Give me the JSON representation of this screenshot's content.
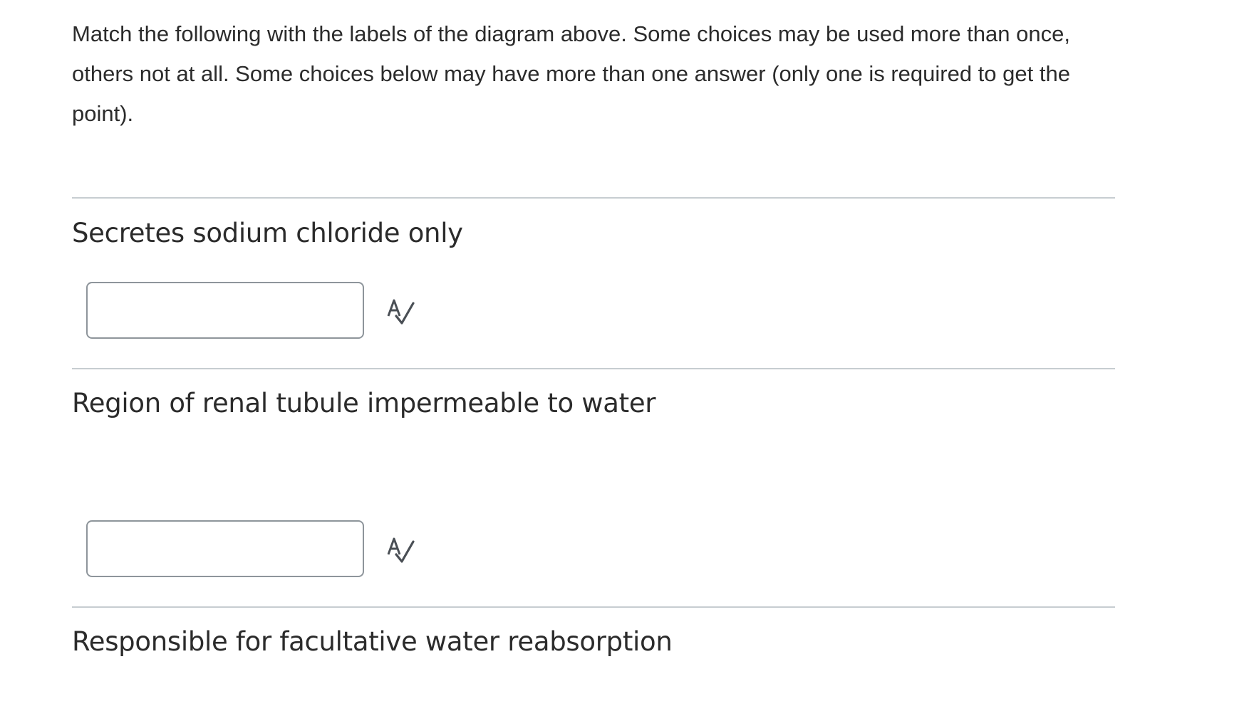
{
  "instructions": {
    "text": "Match the following with the labels of the diagram above. Some choices may be used more than once, others not at all.  Some choices below may have more than one answer (only one is required to get the point)."
  },
  "questions": [
    {
      "prompt": "Secretes sodium chloride only",
      "answer_value": "",
      "spellcheck_icon": "spellcheck-icon"
    },
    {
      "prompt": "Region of renal tubule impermeable to water",
      "answer_value": "",
      "spellcheck_icon": "spellcheck-icon"
    },
    {
      "prompt": "Responsible for facultative water reabsorption"
    }
  ],
  "colors": {
    "text": "#2b2b2b",
    "divider": "#c7cdd1",
    "input_border": "#8e959b",
    "icon": "#4a4f55"
  }
}
